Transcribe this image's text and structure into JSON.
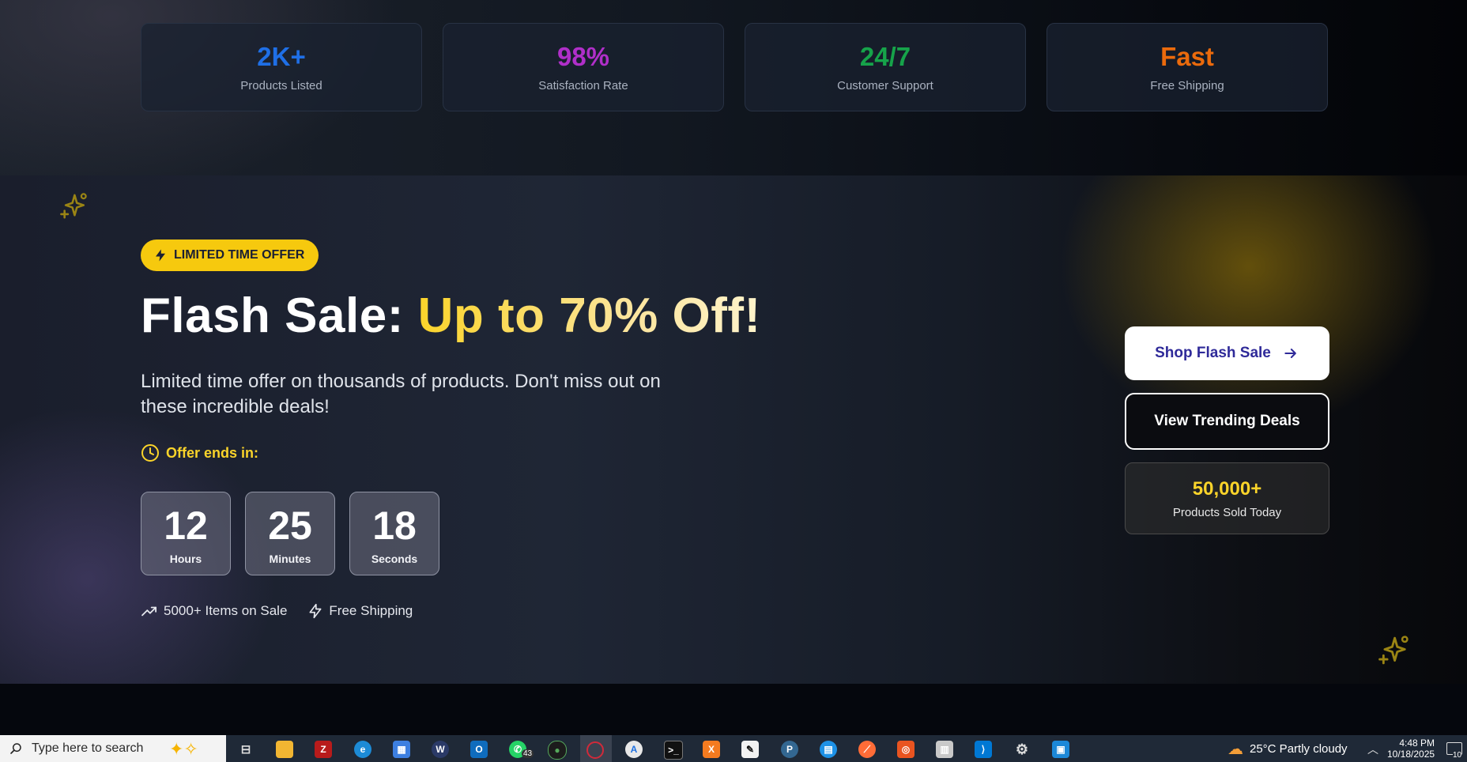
{
  "stats": [
    {
      "value": "2K+",
      "label": "Products Listed",
      "color": "#1f6fe6"
    },
    {
      "value": "98%",
      "label": "Satisfaction Rate",
      "color": "#b02fc9"
    },
    {
      "value": "24/7",
      "label": "Customer Support",
      "color": "#16a34a"
    },
    {
      "value": "Fast",
      "label": "Free Shipping",
      "color": "#ea6a0c"
    }
  ],
  "flash": {
    "badge": "LIMITED TIME OFFER",
    "headline_plain": "Flash Sale: ",
    "headline_highlight": "Up to 70% Off!",
    "description": "Limited time offer on thousands of products. Don't miss out on these incredible deals!",
    "offer_ends": "Offer ends in:",
    "timer": [
      {
        "value": "12",
        "label": "Hours"
      },
      {
        "value": "25",
        "label": "Minutes"
      },
      {
        "value": "18",
        "label": "Seconds"
      }
    ],
    "features": [
      {
        "icon": "trending-up-icon",
        "text": "5000+ Items on Sale"
      },
      {
        "icon": "lightning-icon",
        "text": "Free Shipping"
      }
    ],
    "shop_button": "Shop Flash Sale",
    "trending_button": "View Trending Deals",
    "sold_count": "50,000+",
    "sold_label": "Products Sold Today",
    "accent_color": "#fbd42a"
  },
  "taskbar": {
    "search_placeholder": "Type here to search",
    "whatsapp_badge": "43",
    "weather": "25°C  Partly cloudy",
    "time": "4:48 PM",
    "date": "10/18/2025",
    "notification_count": "10"
  }
}
